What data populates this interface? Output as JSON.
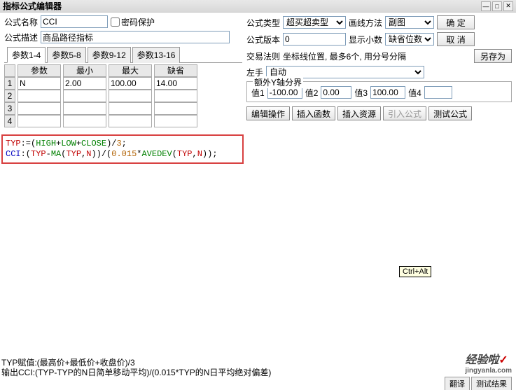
{
  "title": "指标公式编辑器",
  "labels": {
    "name": "公式名称",
    "desc": "公式描述",
    "pwd": "密码保护",
    "type": "公式类型",
    "draw": "画线方法",
    "ver": "公式版本",
    "dec": "显示小数",
    "rule": "交易法则",
    "rule_hint": "坐标线位置, 最多6个, 用分号分隔",
    "hand": "左手",
    "extra_y": "额外Y轴分界",
    "v1": "值1",
    "v2": "值2",
    "v3": "值3",
    "v4": "值4"
  },
  "values": {
    "name": "CCI",
    "desc": "商品路径指标",
    "type_sel": "超买超卖型",
    "draw_sel": "副图",
    "ver": "0",
    "dec_sel": "缺省位数",
    "hand_sel": "自动",
    "v1": "-100.00",
    "v2": "0.00",
    "v3": "100.00",
    "v4": ""
  },
  "buttons": {
    "ok": "确 定",
    "cancel": "取 消",
    "saveas": "另存为",
    "edit_ops": "编辑操作",
    "ins_func": "插入函数",
    "ins_res": "插入资源",
    "imp_formula": "引入公式",
    "test": "测试公式"
  },
  "param_tabs": [
    "参数1-4",
    "参数5-8",
    "参数9-12",
    "参数13-16"
  ],
  "param_headers": {
    "p": "参数",
    "min": "最小",
    "max": "最大",
    "def": "缺省"
  },
  "params": [
    [
      "N",
      "2.00",
      "100.00",
      "14.00"
    ],
    [
      "",
      "",
      "",
      ""
    ],
    [
      "",
      "",
      "",
      ""
    ],
    [
      "",
      "",
      "",
      ""
    ]
  ],
  "tooltip": "Ctrl+Alt",
  "footer": {
    "l1": "TYP赋值:(最高价+最低价+收盘价)/3",
    "l2": "输出CCI:(TYP-TYP的N日简单移动平均)/(0.015*TYP的N日平均绝对偏差)"
  },
  "watermark": {
    "brand": "经验啦",
    "check": "✓",
    "url": "jingyanla.com"
  },
  "bottom_tabs": [
    "翻译",
    "测试结果"
  ]
}
